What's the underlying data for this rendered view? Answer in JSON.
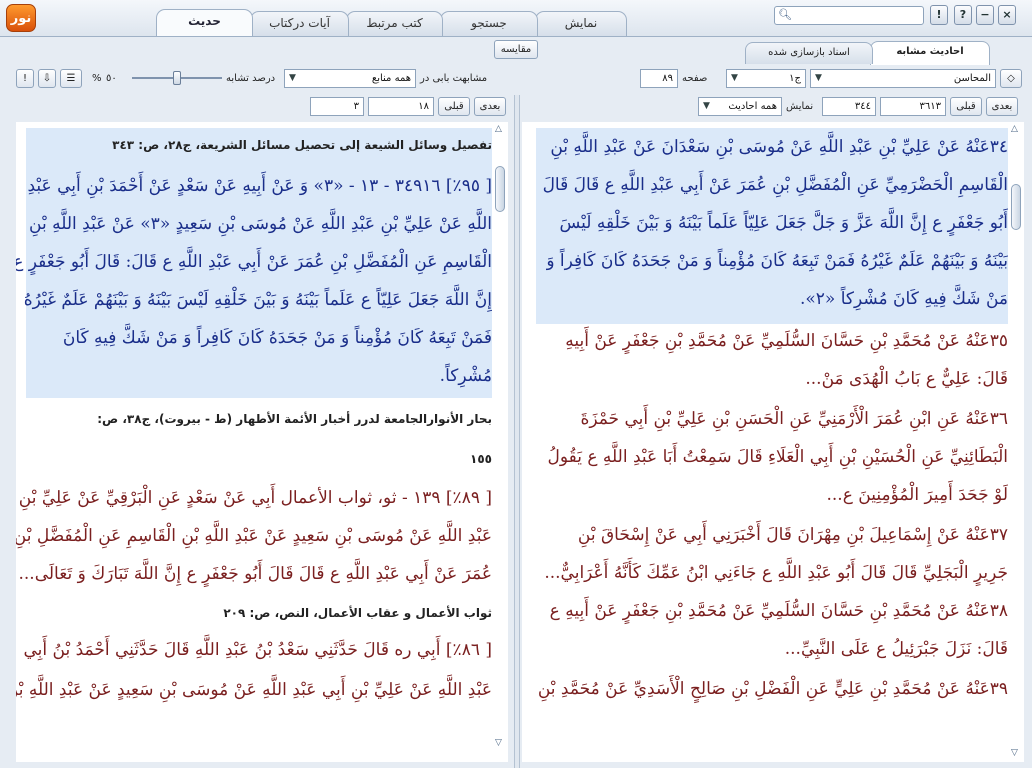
{
  "app": {
    "logo_text": "نور"
  },
  "main_tabs": [
    "نمایش",
    "جستجو",
    "کتب مرتبط",
    "آیات درکتاب",
    "حدیث"
  ],
  "window_buttons": [
    "!",
    "?",
    "−",
    "×"
  ],
  "compare_button": "مقایسه",
  "right_panel": {
    "subtabs": [
      "احادیث مشابه",
      "اسناد بازسازی شده"
    ],
    "book_field": "المحاسن",
    "volume_field": "ج١",
    "page_label": "صفحه",
    "page_value": "٨٩",
    "nav_next": "بعدی",
    "nav_prev": "قبلی",
    "count_1": "٣٦١٣",
    "count_2": "٣٤٤",
    "show_label": "نمایش",
    "show_value": "همه احادیث",
    "lines": [
      "٣٤عَنْهُ عَنْ عَلِيِّ بْنِ عَبْدِ اللَّهِ عَنْ مُوسَى بْنِ سَعْدَانَ عَنْ عَبْدِ اللَّهِ بْنِ",
      "الْقَاسِمِ الْحَضْرَمِيِّ عَنِ الْمُفَضَّلِ بْنِ عُمَرَ عَنْ أَبِي عَبْدِ اللَّهِ ع قَالَ قَالَ",
      "أَبُو جَعْفَرٍ ع إِنَّ اللَّهَ عَزَّ وَ جَلَّ جَعَلَ عَلِيّاً عَلَماً بَيْنَهُ وَ بَيْنَ خَلْقِهِ لَيْسَ",
      "بَيْنَهُ وَ بَيْنَهُمْ عَلَمٌ غَيْرُهُ فَمَنْ تَبِعَهُ كَانَ مُؤْمِناً وَ مَنْ جَحَدَهُ كَانَ كَافِراً وَ",
      "مَنْ شَكَّ فِيهِ كَانَ مُشْرِكاً «٢».",
      "٣٥عَنْهُ عَنْ مُحَمَّدِ بْنِ حَسَّانَ السُّلَمِيِّ عَنْ مُحَمَّدِ بْنِ جَعْفَرٍ عَنْ أَبِيهِ",
      "قَالَ: عَلِيٌّ ع بَابُ الْهُدَى مَنْ...",
      "٣٦عَنْهُ عَنِ ابْنِ عُمَرَ الْأَرْمَنِيِّ عَنِ الْحَسَنِ بْنِ عَلِيِّ بْنِ أَبِي حَمْزَةَ",
      "الْبَطَائِنِيِّ عَنِ الْحُسَيْنِ بْنِ أَبِي الْعَلَاءِ قَالَ سَمِعْتُ أَبَا عَبْدِ اللَّهِ ع يَقُولُ",
      "لَوْ جَحَدَ أَمِيرَ الْمُؤْمِنِينَ ع...",
      "٣٧عَنْهُ عَنْ إِسْمَاعِيلَ بْنِ مِهْرَانَ قَالَ أَخْبَرَنِي أَبِي عَنْ إِسْحَاقَ بْنِ",
      "جَرِيرٍ الْبَجَلِيِّ قَالَ قَالَ أَبُو عَبْدِ اللَّهِ ع جَاءَنِي ابْنُ عَمِّكَ كَأَنَّهُ أَعْرَابِيٌّ...",
      "٣٨عَنْهُ عَنْ مُحَمَّدِ بْنِ حَسَّانَ السُّلَمِيِّ عَنْ مُحَمَّدِ بْنِ جَعْفَرٍ عَنْ أَبِيهِ ع",
      "قَالَ: نَزَلَ جَبْرَئِيلُ ع عَلَى النَّبِيِّ...",
      "٣٩عَنْهُ عَنْ مُحَمَّدِ بْنِ عَلِيٍّ عَنِ الْفَضْلِ بْنِ صَالِحٍ الْأَسَدِيِّ عَنْ مُحَمَّدِ بْنِ"
    ]
  },
  "left_panel": {
    "similarity_label": "مشابهت بابی در",
    "similarity_value": "همه منابع",
    "percent_label": "درصد تشابه",
    "percent_value": "٥٠",
    "percent_sign": "%",
    "similarity_level": 0.5,
    "nav_next": "بعدی",
    "nav_prev": "قبلی",
    "count_1": "١٨",
    "count_2": "٣",
    "lines": [
      "تفصيل وسائل الشيعة إلى تحصيل مسائل الشريعة، ج٢٨، ص: ٣٤٣",
      "[ ٩٥٪] ٣٤٩١٦ - ١٣ - «٣» وَ عَنْ أَبِيهِ عَنْ سَعْدٍ عَنْ أَحْمَدَ بْنِ أَبِي عَبْدِ",
      "اللَّهِ عَنْ عَلِيِّ بْنِ عَبْدِ اللَّهِ عَنْ مُوسَى بْنِ سَعِيدٍ «٣» عَنْ عَبْدِ اللَّهِ بْنِ",
      "الْقَاسِمِ عَنِ الْمُفَضَّلِ بْنِ عُمَرَ عَنْ أَبِي عَبْدِ اللَّهِ ع قَالَ: قَالَ أَبُو جَعْفَرٍ ع",
      "إِنَّ اللَّهَ جَعَلَ عَلِيّاً ع عَلَماً بَيْنَهُ وَ بَيْنَ خَلْقِهِ لَيْسَ بَيْنَهُ وَ بَيْنَهُمْ عَلَمٌ غَيْرُهُ",
      "فَمَنْ تَبِعَهُ كَانَ مُؤْمِناً وَ مَنْ جَحَدَهُ كَانَ كَافِراً وَ مَنْ شَكَّ فِيهِ كَانَ",
      "مُشْرِكاً.",
      "بحار الأنوارالجامعة لدرر أخبار الأئمة الأطهار (ط - بيروت)، ج٣٨، ص:",
      "١٥٥",
      "[ ٨٩٪] ١٣٩ - ثو، ثواب الأعمال أَبِي عَنْ سَعْدٍ عَنِ الْبَرْقِيِّ عَنْ عَلِيِّ بْنِ",
      "عَبْدِ اللَّهِ عَنْ مُوسَى بْنِ سَعِيدٍ عَنْ عَبْدِ اللَّهِ بْنِ الْقَاسِمِ عَنِ الْمُفَضَّلِ بْنِ",
      "عُمَرَ عَنْ أَبِي عَبْدِ اللَّهِ ع قَالَ قَالَ أَبُو جَعْفَرٍ ع إِنَّ اللَّهَ تَبَارَكَ وَ تَعَالَى...",
      "ثواب الأعمال و عقاب الأعمال، النص، ص: ٢٠٩",
      "[ ٨٦٪] أَبِي ره قَالَ حَدَّثَنِي سَعْدُ بْنُ عَبْدِ اللَّهِ قَالَ حَدَّثَنِي أَحْمَدُ بْنُ أَبِي",
      "عَبْدِ اللَّهِ عَنْ عَلِيِّ بْنِ أَبِي عَبْدِ اللَّهِ عَنْ مُوسَى بْنِ سَعِيدٍ عَنْ عَبْدِ اللَّهِ بْنِ"
    ]
  }
}
